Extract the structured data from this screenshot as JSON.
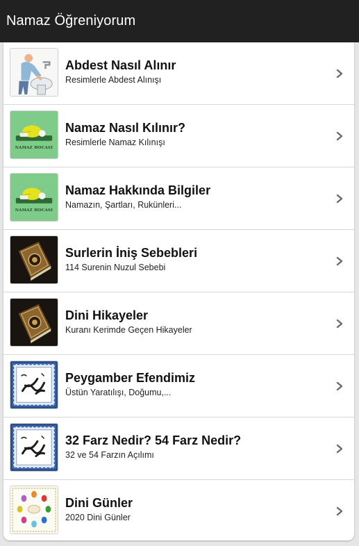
{
  "app": {
    "title": "Namaz Öğreniyorum"
  },
  "colors": {
    "appbar": "#212121",
    "background": "#e6e6e6",
    "chevron": "#6a6a6a"
  },
  "items": [
    {
      "title": "Abdest Nasıl Alınır",
      "subtitle": "Resimlerle Abdest Alınışı",
      "icon": "ablution-image"
    },
    {
      "title": "Namaz Nasıl Kılınır?",
      "subtitle": "Resimlerle Namaz Kılınışı",
      "icon": "praying-man-image",
      "icon_caption": "NAMAZ HOCASI"
    },
    {
      "title": "Namaz Hakkında Bilgiler",
      "subtitle": "Namazın, Şartları, Rukünleri...",
      "icon": "praying-man-image",
      "icon_caption": "NAMAZ HOCASI"
    },
    {
      "title": "Surlerin İniş Sebebleri",
      "subtitle": "114 Surenin Nuzul Sebebi",
      "icon": "quran-book-image"
    },
    {
      "title": "Dini Hikayeler",
      "subtitle": "Kuranı Kerimde Geçen Hikayeler",
      "icon": "quran-book-image"
    },
    {
      "title": "Peygamber Efendimiz",
      "subtitle": "Üstün Yaratılışı, Doğumu,...",
      "icon": "calligraphy-image"
    },
    {
      "title": "32 Farz Nedir? 54 Farz Nedir?",
      "subtitle": "32 ve 54 Farzın Açılımı",
      "icon": "calligraphy-image"
    },
    {
      "title": "Dini Günler",
      "subtitle": "2020 Dini Günler",
      "icon": "colorful-eggs-image"
    }
  ]
}
